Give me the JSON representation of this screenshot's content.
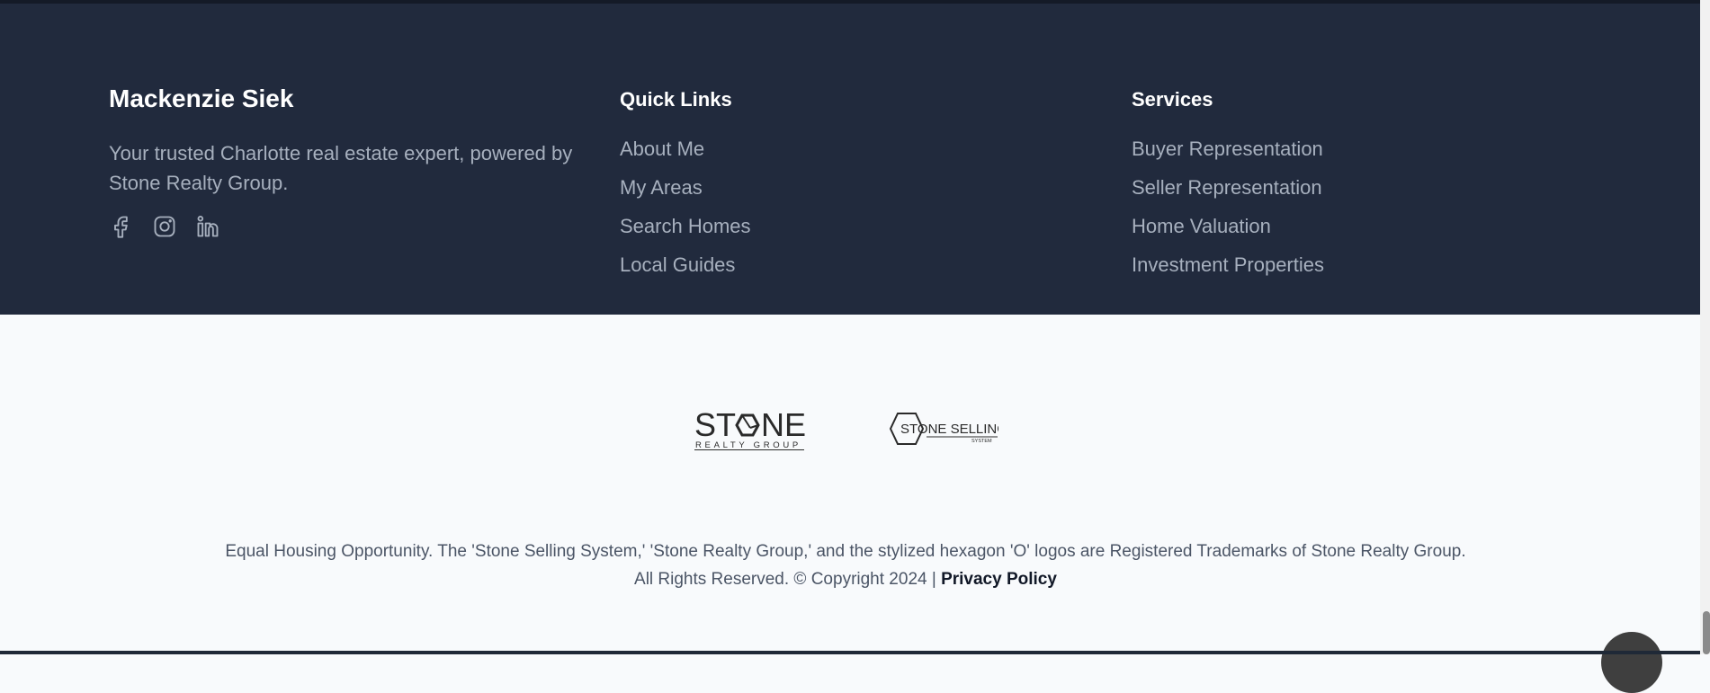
{
  "brand": {
    "name": "Mackenzie Siek",
    "tagline": "Your trusted Charlotte real estate expert, powered by Stone Realty Group."
  },
  "social": [
    "facebook-icon",
    "instagram-icon",
    "linkedin-icon"
  ],
  "quick_links": {
    "title": "Quick Links",
    "items": [
      "About Me",
      "My Areas",
      "Search Homes",
      "Local Guides"
    ]
  },
  "services": {
    "title": "Services",
    "items": [
      "Buyer Representation",
      "Seller Representation",
      "Home Valuation",
      "Investment Properties"
    ]
  },
  "logos": {
    "stone_realty": {
      "word": "STONE",
      "sub": "REALTY GROUP"
    },
    "stone_selling": {
      "word": "STONE SELLING",
      "sub": "SYSTEM"
    }
  },
  "legal": {
    "text": "Equal Housing Opportunity. The 'Stone Selling System,' 'Stone Realty Group,' and the stylized hexagon 'O' logos are Registered Trademarks of Stone Realty Group. All Rights Reserved. © Copyright 2024 | ",
    "privacy_label": "Privacy Policy"
  },
  "colors": {
    "footer_bg": "#212a3d",
    "muted_text": "#a7b0be",
    "page_bg": "#f8fafc"
  }
}
